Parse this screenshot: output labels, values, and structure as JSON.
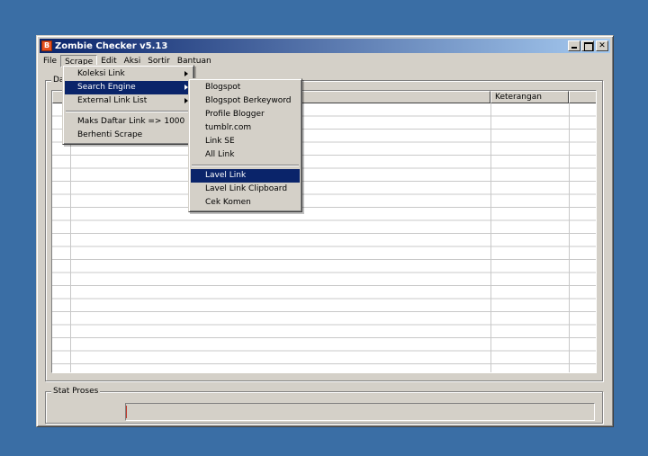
{
  "window": {
    "title": "Zombie Checker v5.13",
    "icon_letter": "B"
  },
  "menubar": [
    "File",
    "Scrape",
    "Edit",
    "Aksi",
    "Sortir",
    "Bantuan"
  ],
  "scrape_menu": {
    "items": [
      "Koleksi Link",
      "Search Engine",
      "External Link List"
    ],
    "items_after_sep": [
      "Maks Daftar Link => 1000",
      "Berhenti Scrape"
    ]
  },
  "search_engine_menu": {
    "items": [
      "Blogspot",
      "Blogspot Berkeyword",
      "Profile Blogger",
      "tumblr.com",
      "Link SE",
      "All Link"
    ],
    "items_after_sep": [
      "Lavel Link",
      "Lavel Link Clipboard",
      "Cek Komen"
    ]
  },
  "list_group": {
    "legend": "Da",
    "columns": {
      "keterangan": "Keterangan"
    }
  },
  "stat_group": {
    "legend": "Stat Proses",
    "progress_fraction": 0
  }
}
